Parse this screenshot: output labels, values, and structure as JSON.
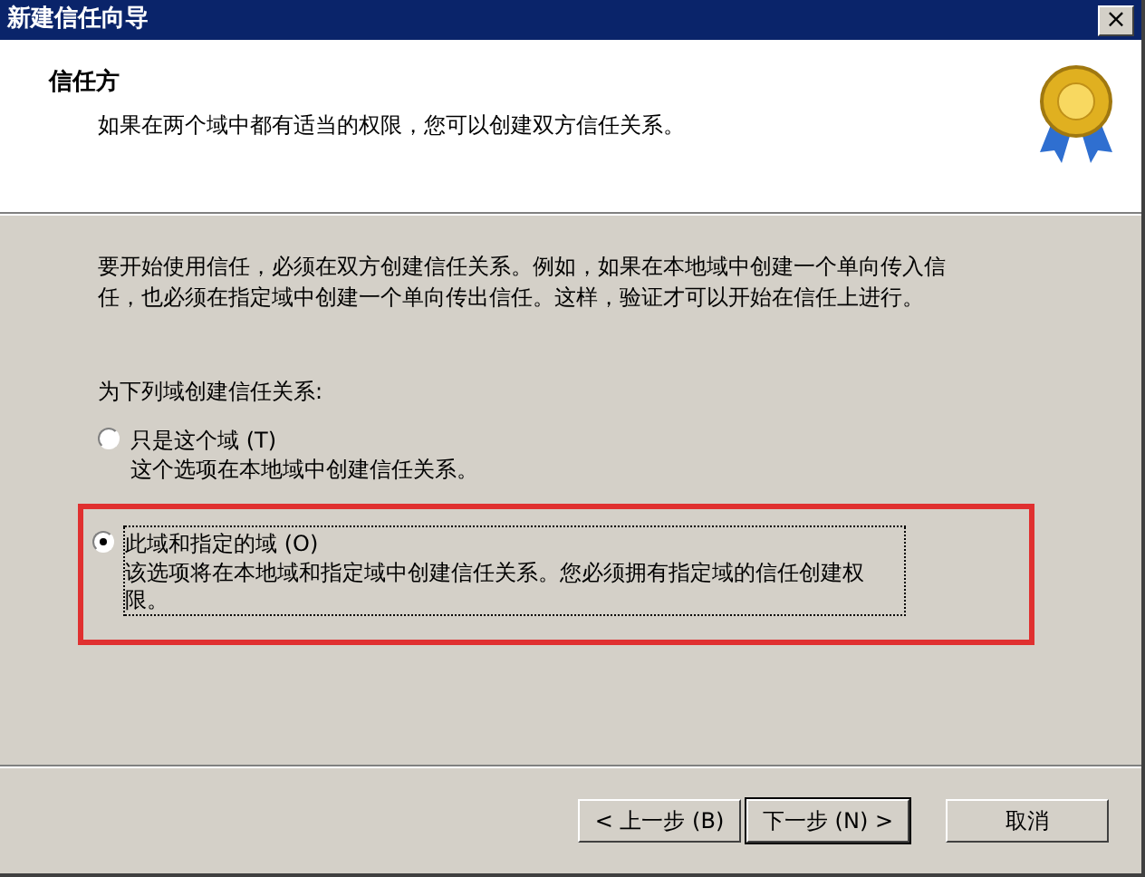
{
  "window": {
    "title": "新建信任向导",
    "close": "×"
  },
  "header": {
    "title": "信任方",
    "subtitle": "如果在两个域中都有适当的权限，您可以创建双方信任关系。"
  },
  "intro": "要开始使用信任，必须在双方创建信任关系。例如，如果在本地域中创建一个单向传入信任，也必须在指定域中创建一个单向传出信任。这样，验证才可以开始在信任上进行。",
  "group_label": "为下列域创建信任关系:",
  "options": [
    {
      "label": "只是这个域 (T)",
      "description": "这个选项在本地域中创建信任关系。",
      "selected": false,
      "highlighted": false
    },
    {
      "label": "此域和指定的域 (O)",
      "description": "该选项将在本地域和指定域中创建信任关系。您必须拥有指定域的信任创建权限。",
      "selected": true,
      "highlighted": true
    }
  ],
  "buttons": [
    {
      "label": "< 上一步 (B)",
      "default": false
    },
    {
      "label": "下一步 (N) >",
      "default": true
    },
    {
      "label": "取消",
      "default": false
    }
  ]
}
